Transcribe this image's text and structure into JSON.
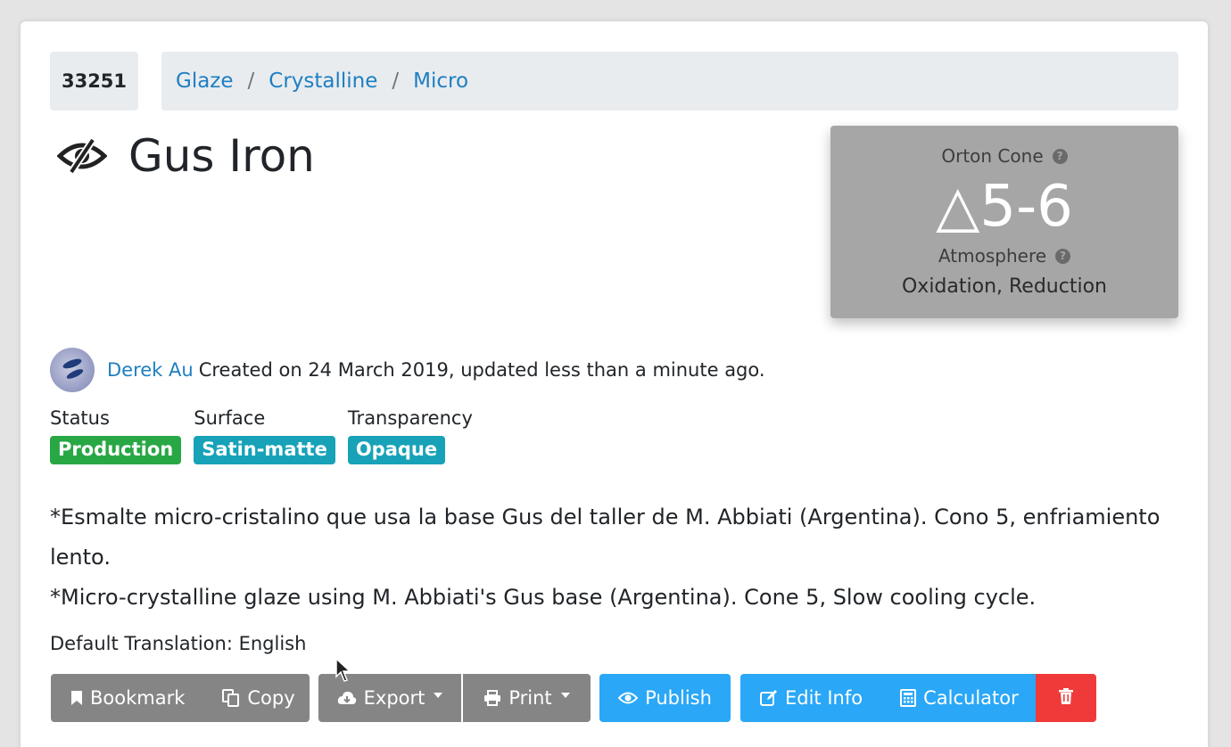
{
  "recipe_id": "33251",
  "breadcrumb": [
    "Glaze",
    "Crystalline",
    "Micro"
  ],
  "title": "Gus Iron",
  "cone_panel": {
    "cone_label": "Orton Cone",
    "cone_value": "△5-6",
    "atmosphere_label": "Atmosphere",
    "atmosphere_value": "Oxidation, Reduction"
  },
  "author": {
    "name": "Derek Au",
    "meta": "Created on 24 March 2019, updated less than a minute ago."
  },
  "properties": [
    {
      "label": "Status",
      "value": "Production",
      "color": "#28a745"
    },
    {
      "label": "Surface",
      "value": "Satin-matte",
      "color": "#17a2b8"
    },
    {
      "label": "Transparency",
      "value": "Opaque",
      "color": "#17a2b8"
    }
  ],
  "description": {
    "line1": "*Esmalte micro-cristalino que usa la base Gus del taller de M. Abbiati  (Argentina). Cono 5, enfriamiento lento.",
    "line2": "*Micro-crystalline glaze using M. Abbiati's Gus  base (Argentina). Cone 5, Slow cooling cycle."
  },
  "default_translation": "Default Translation: English",
  "buttons": {
    "bookmark": "Bookmark",
    "copy": "Copy",
    "export": "Export",
    "print": "Print",
    "publish": "Publish",
    "edit_info": "Edit Info",
    "calculator": "Calculator"
  },
  "colors": {
    "link": "#1e7fc1",
    "grey_button": "#858585",
    "blue_button": "#2aa7f7",
    "red_button": "#f03a3a"
  }
}
